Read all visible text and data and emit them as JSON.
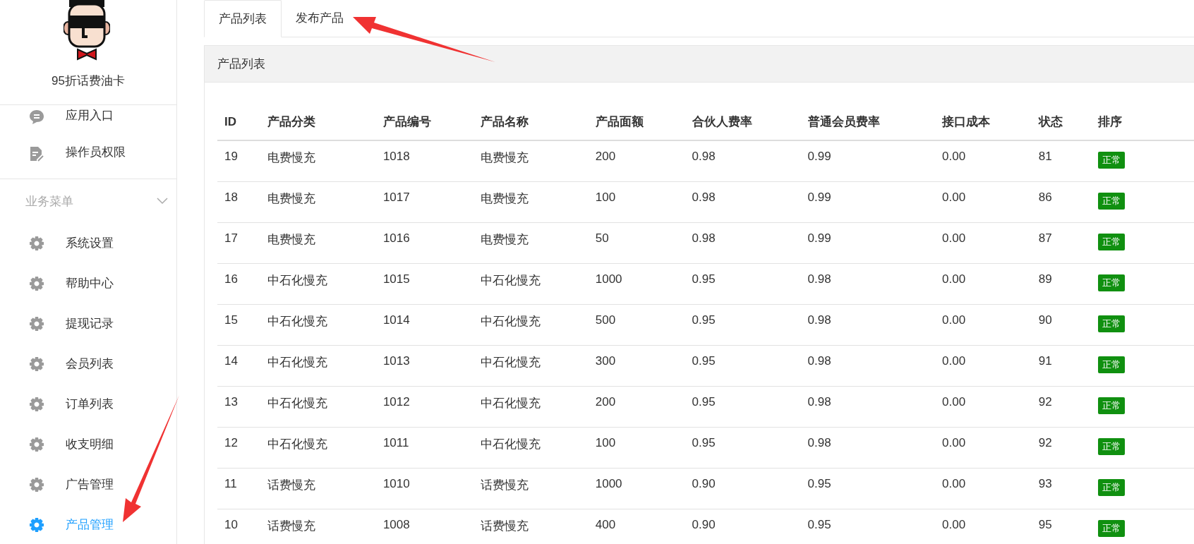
{
  "sidebar": {
    "title": "95折话费油卡",
    "top_items": [
      {
        "label": "应用入口",
        "selected": false
      },
      {
        "label": "操作员权限",
        "selected": false
      }
    ],
    "section": {
      "label": "业务菜单",
      "expanded": true,
      "items": [
        {
          "label": "系统设置",
          "selected": false
        },
        {
          "label": "帮助中心",
          "selected": false
        },
        {
          "label": "提现记录",
          "selected": false
        },
        {
          "label": "会员列表",
          "selected": false
        },
        {
          "label": "订单列表",
          "selected": false
        },
        {
          "label": "收支明细",
          "selected": false
        },
        {
          "label": "广告管理",
          "selected": false
        },
        {
          "label": "产品管理",
          "selected": true
        }
      ]
    }
  },
  "tabs": [
    {
      "label": "产品列表",
      "selected": true
    },
    {
      "label": "发布产品",
      "selected": false
    }
  ],
  "panel": {
    "title": "产品列表"
  },
  "table": {
    "columns": [
      "ID",
      "产品分类",
      "产品编号",
      "产品名称",
      "产品面额",
      "合伙人费率",
      "普通会员费率",
      "接口成本",
      "状态",
      "排序"
    ],
    "rows": [
      [
        "19",
        "电费慢充",
        "1018",
        "电费慢充",
        "200",
        "0.98",
        "0.99",
        "0.00",
        "81",
        "正常"
      ],
      [
        "18",
        "电费慢充",
        "1017",
        "电费慢充",
        "100",
        "0.98",
        "0.99",
        "0.00",
        "86",
        "正常"
      ],
      [
        "17",
        "电费慢充",
        "1016",
        "电费慢充",
        "50",
        "0.98",
        "0.99",
        "0.00",
        "87",
        "正常"
      ],
      [
        "16",
        "中石化慢充",
        "1015",
        "中石化慢充",
        "1000",
        "0.95",
        "0.98",
        "0.00",
        "89",
        "正常"
      ],
      [
        "15",
        "中石化慢充",
        "1014",
        "中石化慢充",
        "500",
        "0.95",
        "0.98",
        "0.00",
        "90",
        "正常"
      ],
      [
        "14",
        "中石化慢充",
        "1013",
        "中石化慢充",
        "300",
        "0.95",
        "0.98",
        "0.00",
        "91",
        "正常"
      ],
      [
        "13",
        "中石化慢充",
        "1012",
        "中石化慢充",
        "200",
        "0.95",
        "0.98",
        "0.00",
        "92",
        "正常"
      ],
      [
        "12",
        "中石化慢充",
        "1011",
        "中石化慢充",
        "100",
        "0.95",
        "0.98",
        "0.00",
        "92",
        "正常"
      ],
      [
        "11",
        "话费慢充",
        "1010",
        "话费慢充",
        "1000",
        "0.90",
        "0.95",
        "0.00",
        "93",
        "正常"
      ],
      [
        "10",
        "话费慢充",
        "1008",
        "话费慢充",
        "400",
        "0.90",
        "0.95",
        "0.00",
        "95",
        "正常"
      ]
    ]
  }
}
